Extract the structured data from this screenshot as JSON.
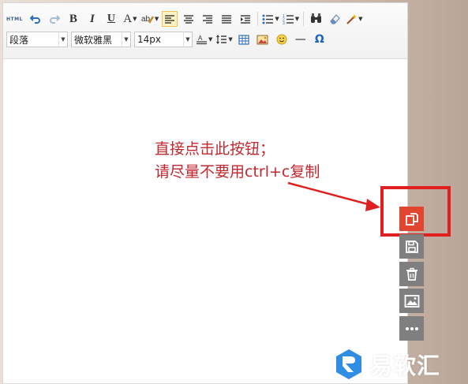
{
  "toolbar": {
    "html_label": "HTML",
    "paragraph_select": "段落",
    "font_select": "微软雅黑",
    "size_select": "14px",
    "omega_symbol": "Ω",
    "hr_symbol": "—",
    "bold": "B",
    "italic": "I",
    "underline": "U",
    "font_color": "A"
  },
  "annotation": {
    "line1": "直接点击此按钮；",
    "line2": "请尽量不要用ctrl+c复制"
  },
  "side_buttons": [
    "copy-icon",
    "save-icon",
    "trash-icon",
    "image-icon",
    "more-icon"
  ],
  "watermark": {
    "text": "易软汇"
  },
  "colors": {
    "accent_red": "#e24630",
    "annotation_red": "#c1272d",
    "side_button_gray": "#7f7f7f",
    "watermark_blue": "#2f8de4"
  }
}
